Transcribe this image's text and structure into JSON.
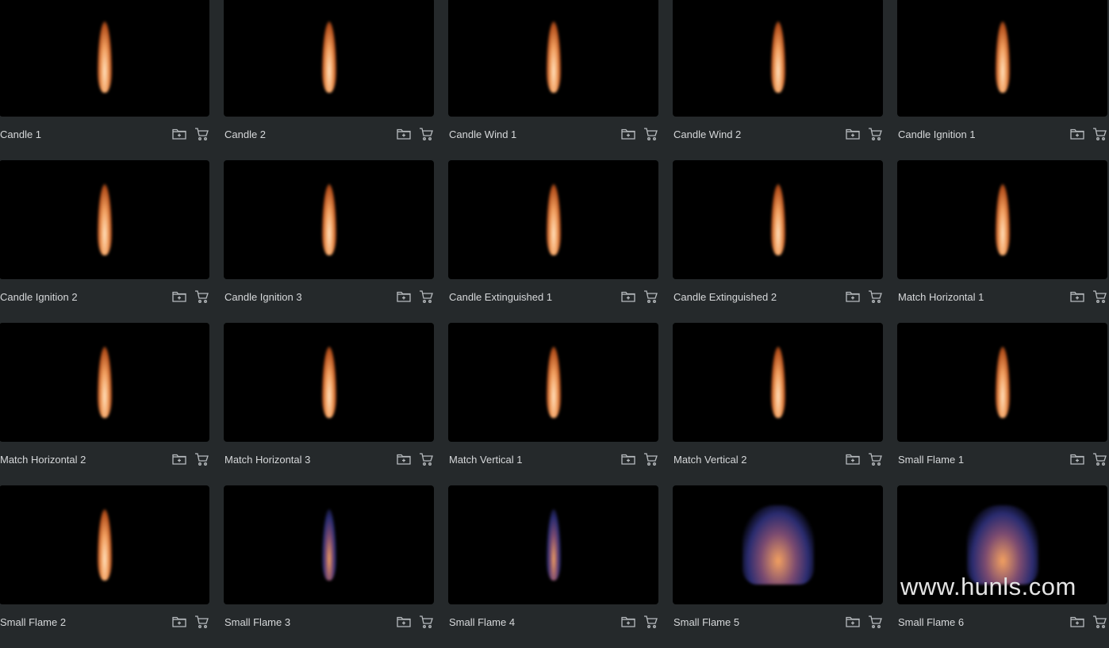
{
  "items": [
    {
      "title": "Candle 1",
      "style": ""
    },
    {
      "title": "Candle 2",
      "style": ""
    },
    {
      "title": "Candle Wind 1",
      "style": ""
    },
    {
      "title": "Candle Wind 2",
      "style": ""
    },
    {
      "title": "Candle Ignition 1",
      "style": ""
    },
    {
      "title": "Candle Ignition 2",
      "style": ""
    },
    {
      "title": "Candle Ignition 3",
      "style": ""
    },
    {
      "title": "Candle Extinguished 1",
      "style": ""
    },
    {
      "title": "Candle Extinguished 2",
      "style": ""
    },
    {
      "title": "Match Horizontal 1",
      "style": ""
    },
    {
      "title": "Match Horizontal 2",
      "style": ""
    },
    {
      "title": "Match Horizontal 3",
      "style": ""
    },
    {
      "title": "Match Vertical 1",
      "style": ""
    },
    {
      "title": "Match Vertical 2",
      "style": ""
    },
    {
      "title": "Small Flame 1",
      "style": ""
    },
    {
      "title": "Small Flame 2",
      "style": ""
    },
    {
      "title": "Small Flame 3",
      "style": "blue"
    },
    {
      "title": "Small Flame 4",
      "style": "blue"
    },
    {
      "title": "Small Flame 5",
      "style": "blue wide"
    },
    {
      "title": "Small Flame 6",
      "style": "blue wide"
    }
  ],
  "icons": {
    "add": "folder-plus-icon",
    "cart": "cart-icon"
  },
  "watermark": "www.hunls.com"
}
